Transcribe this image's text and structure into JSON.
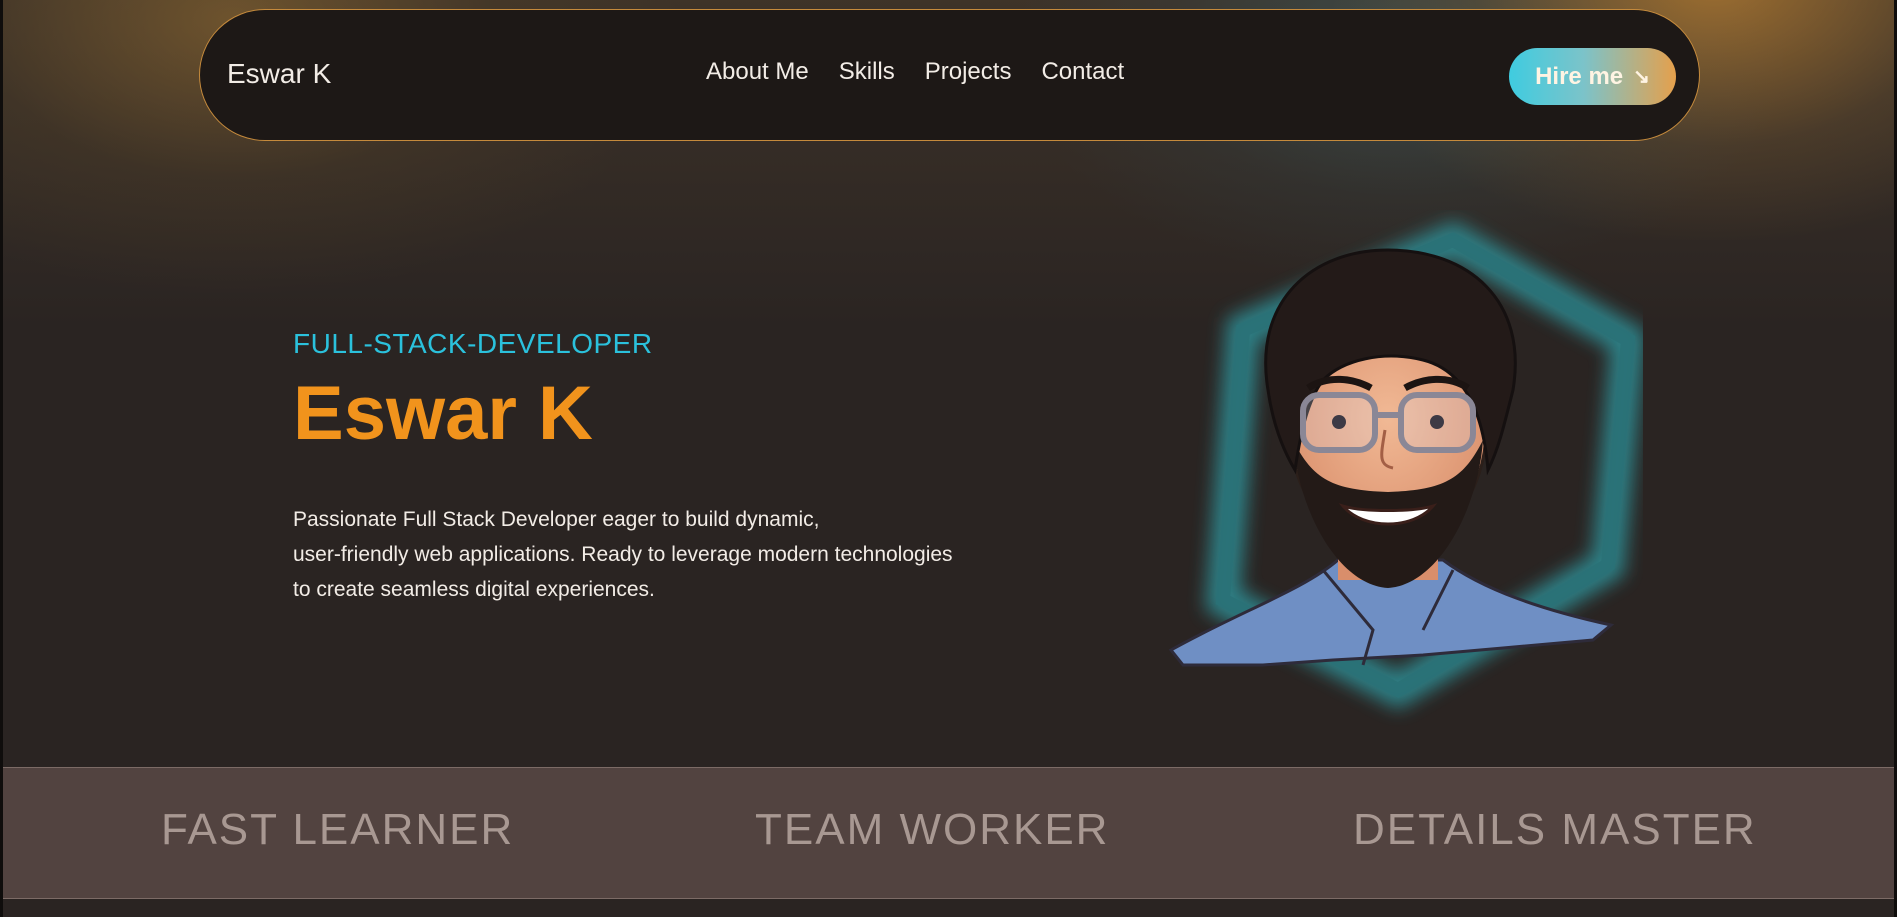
{
  "header": {
    "brand": "Eswar K",
    "nav": [
      {
        "label": "About Me"
      },
      {
        "label": "Skills"
      },
      {
        "label": "Projects"
      },
      {
        "label": "Contact"
      }
    ],
    "cta": {
      "label": "Hire me",
      "icon": "arrow-down-right-icon"
    }
  },
  "hero": {
    "subtitle": "FULL-STACK-DEVELOPER",
    "name": "Eswar K",
    "description_lines": [
      "Passionate Full Stack Developer eager to build dynamic,",
      "user-friendly web applications. Ready to leverage modern technologies",
      "to create seamless digital experiences."
    ],
    "portrait_icon": "avatar-illustration"
  },
  "traits": [
    "FAST LEARNER",
    "TEAM WORKER",
    "DETAILS MASTER"
  ],
  "colors": {
    "background": "#2a2422",
    "accent_orange": "#f1931c",
    "accent_teal": "#2bc1dc",
    "nav_border": "#c58a3c",
    "trait_band": "#524340"
  }
}
